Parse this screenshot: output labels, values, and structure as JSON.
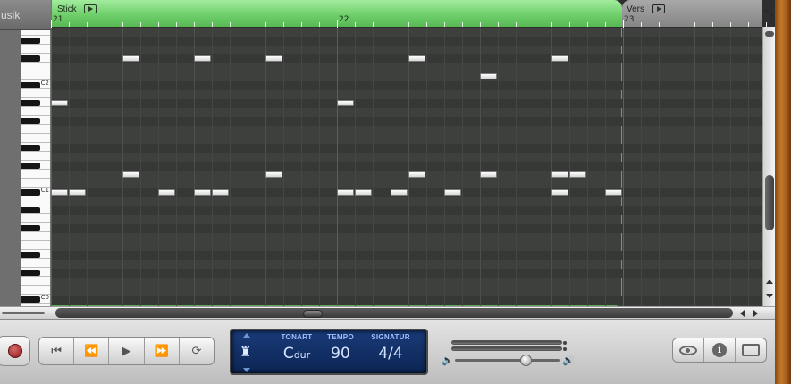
{
  "track": {
    "name": "usik"
  },
  "regions": [
    {
      "title": "Stick",
      "start_bar": "21"
    },
    {
      "title": "Vers",
      "start_bar": "23"
    }
  ],
  "ruler": {
    "bar_21": "21",
    "bar_22": "22",
    "bar_23": "23"
  },
  "keyboard": {
    "labels": [
      "C2",
      "C1",
      "C0"
    ]
  },
  "notes_bars_note": "Notes shown as white rectangles in the piano roll",
  "notes": [
    {
      "row": 3,
      "col": 4
    },
    {
      "row": 3,
      "col": 8
    },
    {
      "row": 3,
      "col": 12
    },
    {
      "row": 3,
      "col": 20
    },
    {
      "row": 3,
      "col": 28
    },
    {
      "row": 5,
      "col": 24
    },
    {
      "row": 8,
      "col": 0
    },
    {
      "row": 8,
      "col": 16
    },
    {
      "row": 16,
      "col": 4
    },
    {
      "row": 16,
      "col": 12
    },
    {
      "row": 16,
      "col": 20
    },
    {
      "row": 16,
      "col": 24
    },
    {
      "row": 16,
      "col": 28
    },
    {
      "row": 16,
      "col": 29
    },
    {
      "row": 18,
      "col": 0
    },
    {
      "row": 18,
      "col": 1
    },
    {
      "row": 18,
      "col": 6
    },
    {
      "row": 18,
      "col": 8
    },
    {
      "row": 18,
      "col": 9
    },
    {
      "row": 18,
      "col": 16
    },
    {
      "row": 18,
      "col": 17
    },
    {
      "row": 18,
      "col": 19
    },
    {
      "row": 18,
      "col": 22
    },
    {
      "row": 18,
      "col": 28
    },
    {
      "row": 18,
      "col": 31
    }
  ],
  "lcd": {
    "tonart_label": "TONART",
    "tempo_label": "TEMPO",
    "signatur_label": "SIGNATUR",
    "key_main": "C",
    "key_mode": "dur",
    "tempo": "90",
    "signature": "4/4"
  },
  "transport": {
    "icons": [
      "go-to-start-icon",
      "rewind-icon",
      "play-icon",
      "fast-forward-icon",
      "cycle-icon"
    ],
    "glyphs": [
      "⏮",
      "⏪",
      "▶",
      "⏩",
      "⟳"
    ]
  },
  "view_buttons": {
    "icons": [
      "eye-icon",
      "info-icon",
      "media-browser-icon"
    ],
    "info_glyph": "i"
  },
  "colors": {
    "region_green": "#6fcf6a",
    "lcd_blue": "#1a3b7a",
    "record_red": "#8a1818"
  }
}
